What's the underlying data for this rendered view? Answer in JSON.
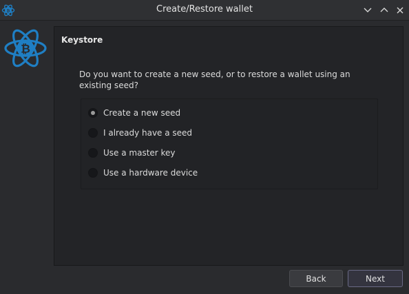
{
  "window": {
    "title": "Create/Restore wallet",
    "controls": [
      "chevron-down-icon",
      "chevron-up-icon",
      "close-icon"
    ]
  },
  "logo": {
    "icon": "electrum-bitcoin-atom-icon",
    "color": "#1f7fc4"
  },
  "panel": {
    "title": "Keystore",
    "question": "Do you want to create a new seed, or to restore a wallet using an existing seed?",
    "options": [
      {
        "label": "Create a new seed",
        "selected": true
      },
      {
        "label": "I already have a seed",
        "selected": false
      },
      {
        "label": "Use a master key",
        "selected": false
      },
      {
        "label": "Use a hardware device",
        "selected": false
      }
    ]
  },
  "buttons": {
    "back_label": "Back",
    "next_label": "Next"
  }
}
